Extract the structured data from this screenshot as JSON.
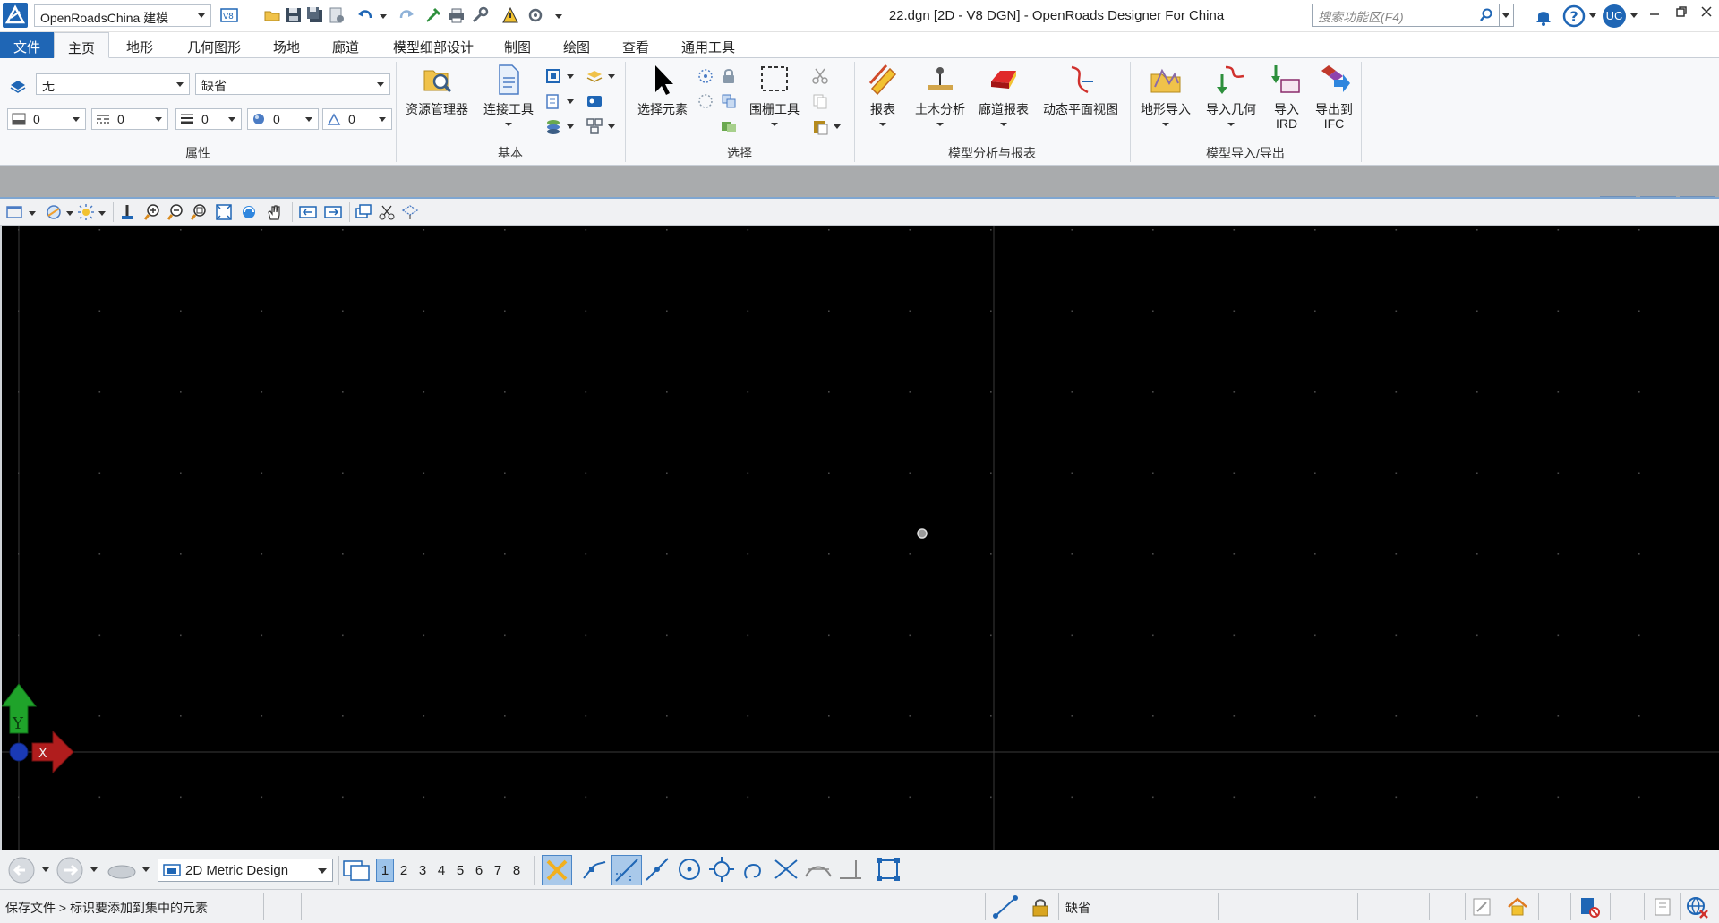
{
  "title_bar": {
    "workflow": "OpenRoadsChina 建模",
    "window_title": "22.dgn [2D - V8 DGN] - OpenRoads Designer For China",
    "search_placeholder": "搜索功能区(F4)",
    "user_initials": "UC"
  },
  "ribbon": {
    "tabs": [
      {
        "label": "文件"
      },
      {
        "label": "主页"
      },
      {
        "label": "地形"
      },
      {
        "label": "几何图形"
      },
      {
        "label": "场地"
      },
      {
        "label": "廊道"
      },
      {
        "label": "模型细部设计"
      },
      {
        "label": "制图"
      },
      {
        "label": "绘图"
      },
      {
        "label": "查看"
      },
      {
        "label": "通用工具"
      }
    ],
    "properties": {
      "label": "属性",
      "level": "无",
      "style": "缺省",
      "color": "0",
      "line_style": "0",
      "weight": "0",
      "transparency": "0",
      "priority": "0"
    },
    "basic": {
      "label": "基本",
      "explorer": "资源管理器",
      "attach_tools": "连接工具"
    },
    "selection": {
      "label": "选择",
      "select_element": "选择元素",
      "fence_tools": "围栅工具"
    },
    "analysis": {
      "label": "模型分析与报表",
      "reports": "报表",
      "civil_analysis": "土木分析",
      "corridor_reports": "廊道报表",
      "dynamic_view": "动态平面视图"
    },
    "import_export": {
      "label": "模型导入/导出",
      "terrain_import": "地形导入",
      "import_geometry": "导入几何",
      "import_ird": "导入\nIRD",
      "import_ird_line1": "导入",
      "import_ird_line2": "IRD",
      "export_ifc_line1": "导出到",
      "export_ifc_line2": "IFC"
    }
  },
  "view": {
    "axis_y_label": "Y",
    "axis_x_label": "X"
  },
  "bottom_toolbar": {
    "model": "2D Metric Design",
    "view_numbers": [
      "1",
      "2",
      "3",
      "4",
      "5",
      "6",
      "7",
      "8"
    ],
    "active_view": "1"
  },
  "status_bar": {
    "message": "保存文件 > 标识要添加到集中的元素",
    "active_level": "缺省"
  },
  "colors": {
    "accent": "#1f66b5",
    "canvas": "#000000",
    "grid_dot": "#4a4a4a",
    "y_axis": "#1fa32a",
    "x_axis": "#b01d1d"
  }
}
